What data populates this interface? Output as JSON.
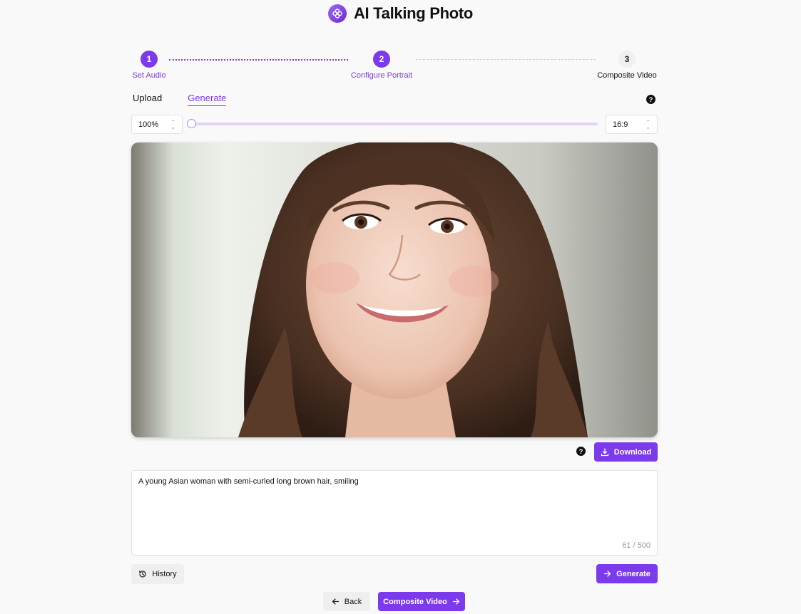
{
  "app": {
    "title": "AI Talking Photo",
    "logo_icon": "flower-icon",
    "accent": "#7c3aed"
  },
  "stepper": {
    "steps": [
      {
        "number": "1",
        "label": "Set Audio",
        "state": "completed"
      },
      {
        "number": "2",
        "label": "Configure Portrait",
        "state": "current"
      },
      {
        "number": "3",
        "label": "Composite Video",
        "state": "upcoming"
      }
    ]
  },
  "tabs": {
    "items": [
      {
        "label": "Upload"
      },
      {
        "label": "Generate"
      }
    ],
    "selected": "Generate",
    "help_icon": "question-icon",
    "help_glyph": "?"
  },
  "controls": {
    "zoom_value": "100%",
    "ratio_value": "16:9",
    "slider_position": 0,
    "chevron_up": "⌃",
    "chevron_down": "⌄"
  },
  "portrait": {
    "subject": "young-asian-woman-smiling-portrait"
  },
  "download": {
    "label": "Download",
    "icon": "download-icon"
  },
  "prompt": {
    "text": "A young Asian woman with semi-curled long brown hair, smiling",
    "counter": "61 / 500"
  },
  "history": {
    "label": "History",
    "icon": "history-icon"
  },
  "generate": {
    "label": "Generate",
    "icon": "arrow-right-icon"
  },
  "nav": {
    "back_label": "Back",
    "back_icon": "arrow-left-icon",
    "composite_label": "Composite Video",
    "composite_icon": "arrow-right-icon"
  }
}
